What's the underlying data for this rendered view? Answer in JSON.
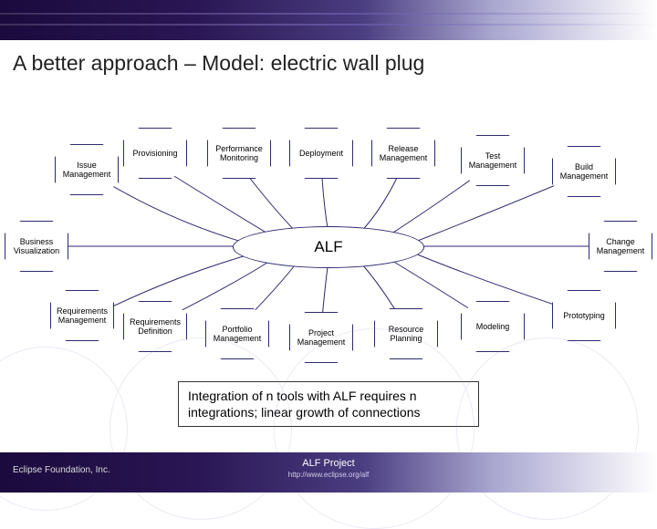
{
  "title": "A better approach – Model: electric wall plug",
  "hub": "ALF",
  "nodes": {
    "top": [
      "Provisioning",
      "Performance Monitoring",
      "Deployment",
      "Release Management",
      "Test Management",
      "Build Management"
    ],
    "left_upper": "Issue Management",
    "left_mid": "Business Visualization",
    "left_lower": "Requirements Management",
    "bottom": [
      "Requirements Definition",
      "Portfolio Management",
      "Project Management",
      "Resource Planning",
      "Modeling",
      "Prototyping"
    ],
    "right_mid": "Change Management"
  },
  "caption": "Integration of n tools with ALF requires n integrations;  linear growth of connections",
  "footer": {
    "org": "Eclipse Foundation, Inc.",
    "project": "ALF Project",
    "url": "http://www.eclipse.org/alf"
  }
}
